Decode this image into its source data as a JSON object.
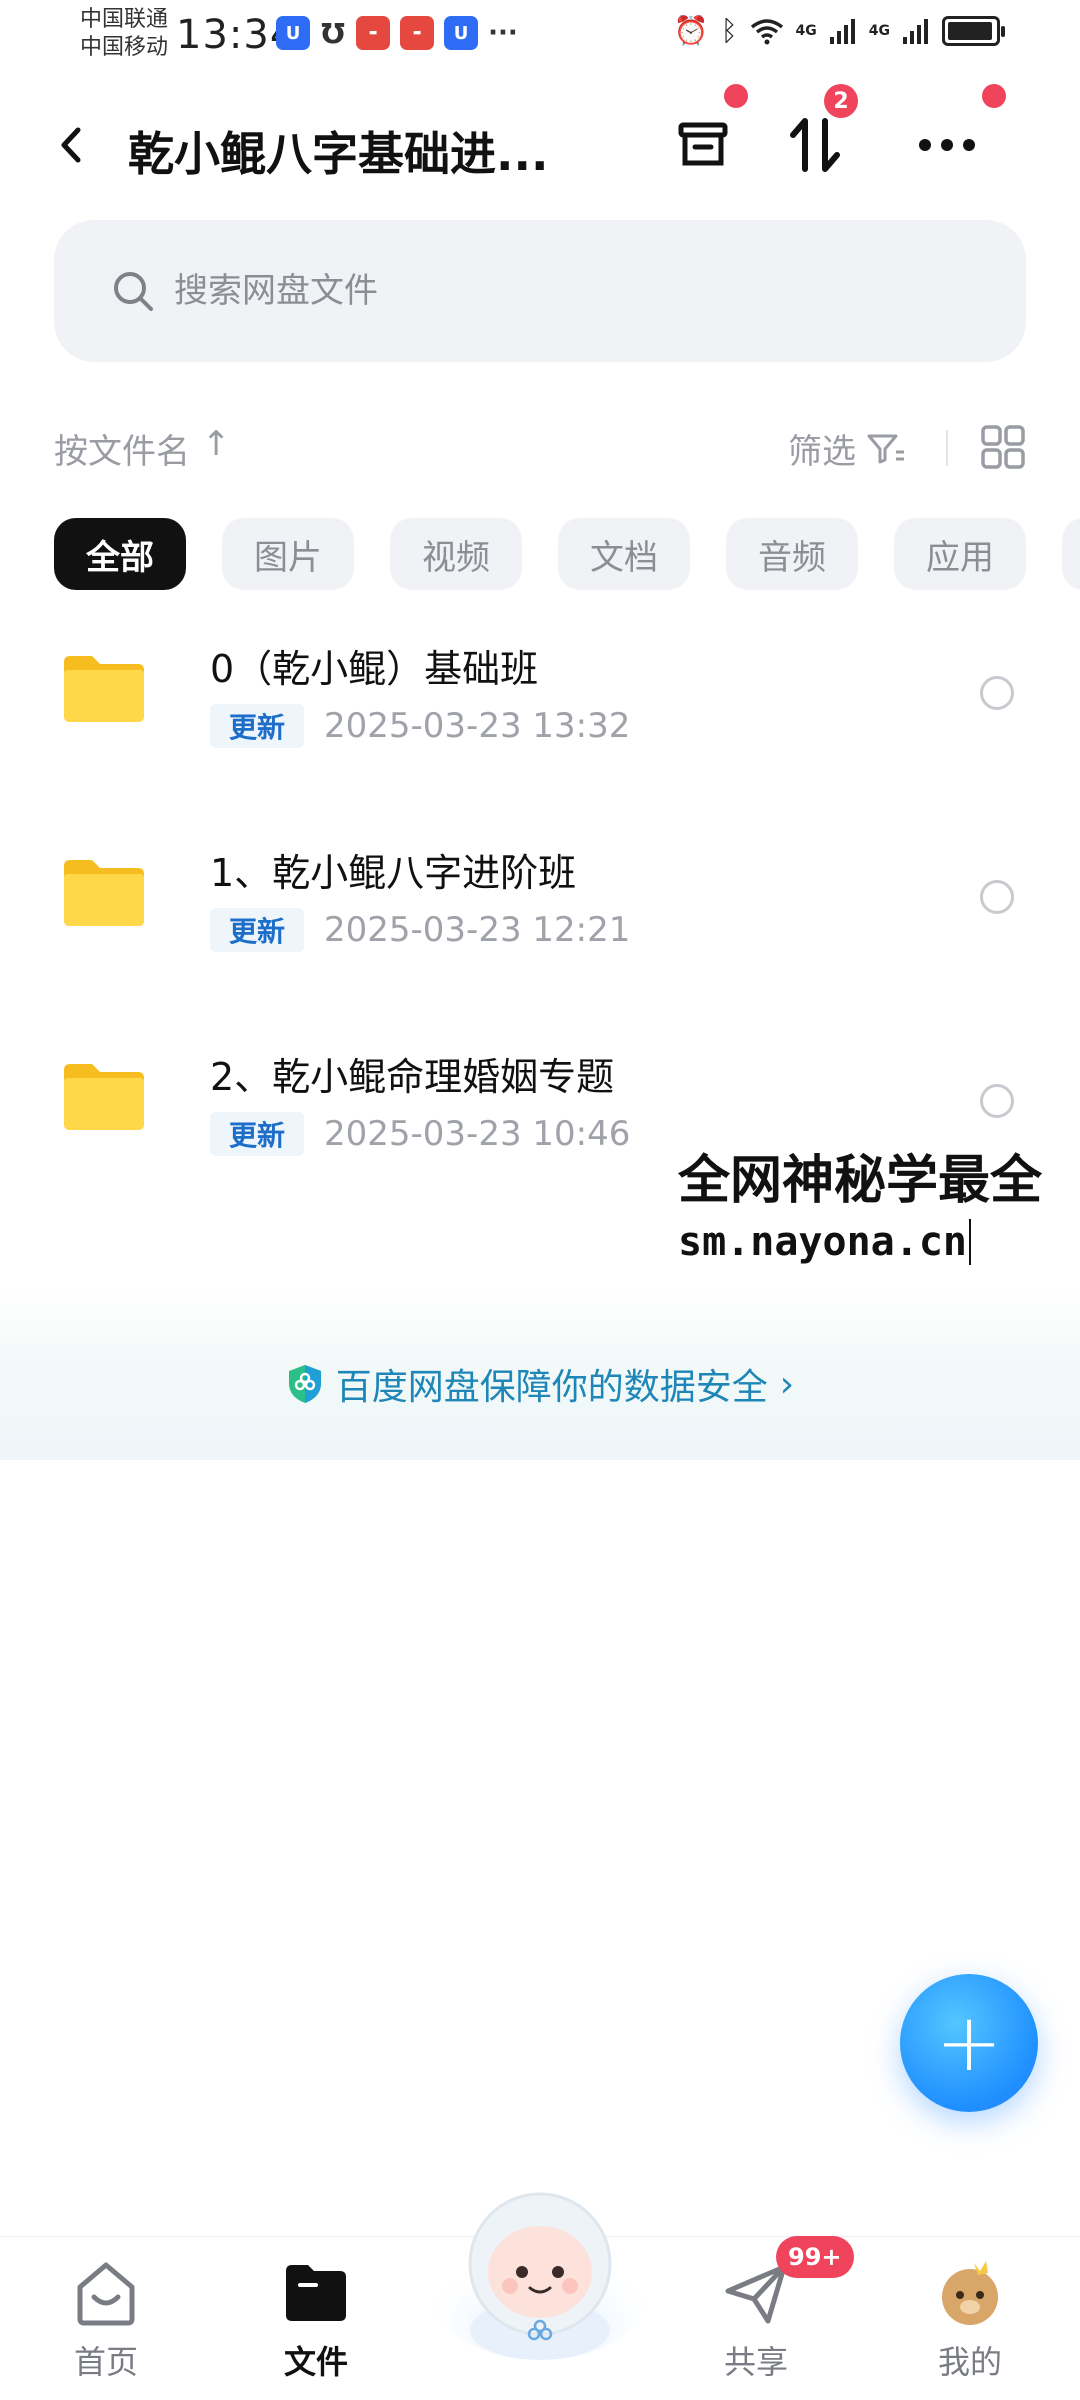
{
  "status_bar": {
    "carrier_1": "中国联通",
    "carrier_2": "中国移动",
    "time": "13:34",
    "notif_dots": "···",
    "net_1": "4G",
    "net_2": "4G"
  },
  "header": {
    "title": "乾小鲲八字基础进...",
    "transfer_badge": "2"
  },
  "search": {
    "placeholder": "搜索网盘文件"
  },
  "sort": {
    "label": "按文件名",
    "arrow": "↑",
    "filter_label": "筛选"
  },
  "chips": [
    "全部",
    "图片",
    "视频",
    "文档",
    "音频",
    "应用"
  ],
  "files": [
    {
      "name": "0（乾小鲲）基础班",
      "tag": "更新",
      "date": "2025-03-23  13:32"
    },
    {
      "name": "1、乾小鲲八字进阶班",
      "tag": "更新",
      "date": "2025-03-23  12:21"
    },
    {
      "name": "2、乾小鲲命理婚姻专题",
      "tag": "更新",
      "date": "2025-03-23  10:46"
    }
  ],
  "watermark": {
    "line1": "全网神秘学最全",
    "line2": "sm.nayona.cn"
  },
  "security": {
    "text": "百度网盘保障你的数据安全",
    "chevron": "›"
  },
  "fab": {
    "label": "+"
  },
  "bottom_nav": {
    "home": "首页",
    "files": "文件",
    "share": "共享",
    "share_badge": "99+",
    "me": "我的"
  },
  "icons": {
    "back": "chevron-left-icon",
    "recycle": "archive-box-icon",
    "transfer": "up-down-arrows-icon",
    "more": "more-horizontal-icon",
    "search": "search-icon",
    "filter": "filter-icon",
    "grid": "grid-view-icon",
    "folder": "folder-icon",
    "shield": "shield-icon"
  },
  "colors": {
    "accent_red": "#f0445d",
    "link_blue": "#1f86b8",
    "fab_blue": "#1f8fff",
    "folder_yellow": "#ffd43b",
    "tag_blue": "#1d6ec9"
  }
}
